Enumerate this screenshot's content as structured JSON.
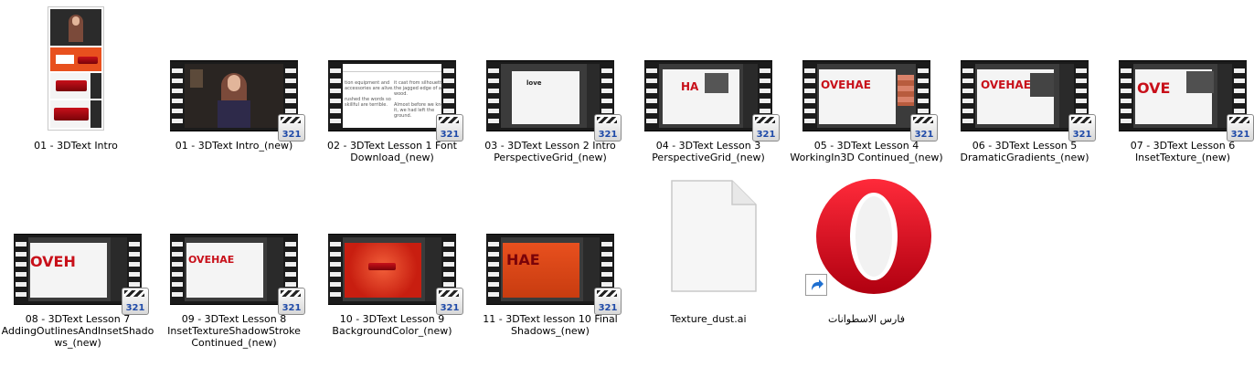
{
  "files": [
    {
      "label": "01 - 3DText Intro",
      "icon": "video-thumbnail-icon"
    },
    {
      "label": "01 - 3DText Intro_(new)",
      "icon": "video-thumbnail-icon"
    },
    {
      "label": "02 - 3DText Lesson 1 Font Download_(new)",
      "icon": "video-thumbnail-icon"
    },
    {
      "label": "03 - 3DText Lesson 2 Intro PerspectiveGrid_(new)",
      "icon": "video-thumbnail-icon"
    },
    {
      "label": "04 - 3DText Lesson 3 PerspectiveGrid_(new)",
      "icon": "video-thumbnail-icon"
    },
    {
      "label": "05 - 3DText Lesson 4 WorkingIn3D Continued_(new)",
      "icon": "video-thumbnail-icon"
    },
    {
      "label": "06 - 3DText Lesson 5 DramaticGradients_(new)",
      "icon": "video-thumbnail-icon"
    },
    {
      "label": "07 - 3DText Lesson 6 InsetTexture_(new)",
      "icon": "video-thumbnail-icon"
    },
    {
      "label": "08 - 3DText Lesson 7 AddingOutlinesAndInsetShadows_(new)",
      "icon": "video-thumbnail-icon"
    },
    {
      "label": "09 - 3DText Lesson 8 InsetTextureShadowStroke Continued_(new)",
      "icon": "video-thumbnail-icon"
    },
    {
      "label": "10 - 3DText Lesson 9 BackgroundColor_(new)",
      "icon": "video-thumbnail-icon"
    },
    {
      "label": "11 - 3DText lesson 10 Final Shadows_(new)",
      "icon": "video-thumbnail-icon"
    },
    {
      "label": "Texture_dust.ai",
      "icon": "blank-document-icon"
    },
    {
      "label": "فارس الاسطوانات",
      "icon": "opera-browser-icon"
    }
  ],
  "player_badge": "321",
  "thumb_texts": {
    "lesson1_col1": "tion equipment and\naccessories are alive.\n\nrushed the words so\nskillful are terrible.",
    "lesson1_col2": "it cast from silhouetted\nthe jagged edge of a\nwood.\n\nAlmost before we knew\nit, we had left the\nground.",
    "lesson2_word": "love",
    "lesson3_text": "HA",
    "lesson4_text": "OVEHAE",
    "lesson5_text": "OVEHAE",
    "lesson6_text": "OVE",
    "lesson7_text": "OVEH",
    "lesson8_text": "OVEHAE",
    "lesson10_text": "HAE"
  },
  "colors": {
    "accent_red": "#c8101a",
    "opera_red": "#e0101f",
    "badge_blue": "#1f4aa8",
    "orange_bg": "#e8501e"
  }
}
